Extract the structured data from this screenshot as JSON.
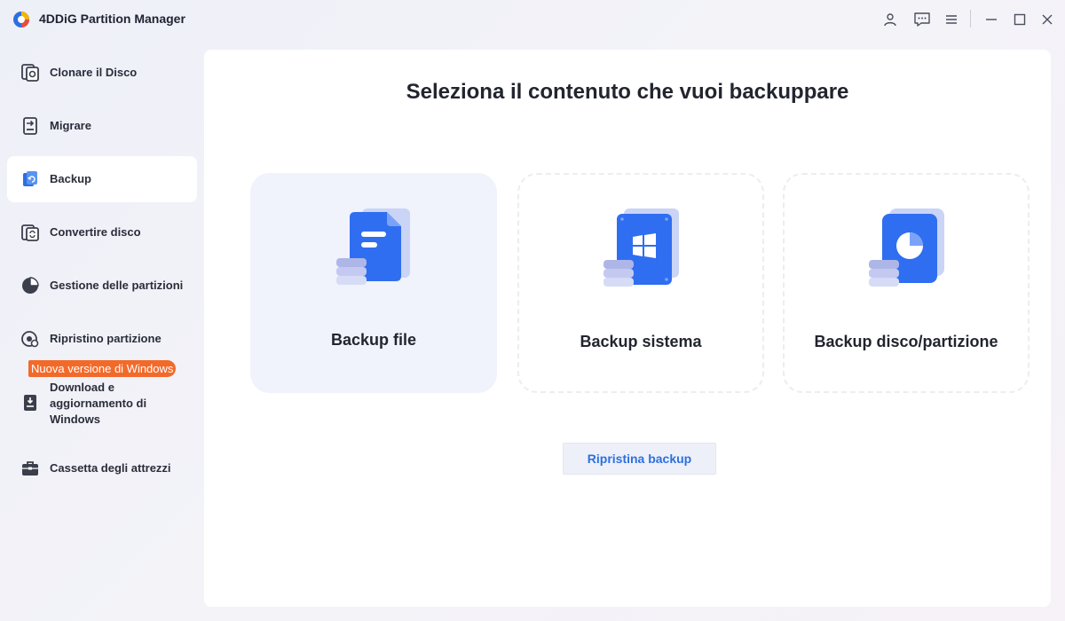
{
  "app": {
    "title": "4DDiG Partition Manager"
  },
  "titlebar": {
    "icons": [
      "user-icon",
      "feedback-icon",
      "menu-icon",
      "minimize-icon",
      "maximize-icon",
      "close-icon"
    ]
  },
  "sidebar": {
    "items": [
      {
        "label": "Clonare il Disco",
        "icon": "clone-disk-icon"
      },
      {
        "label": "Migrare",
        "icon": "migrate-icon"
      },
      {
        "label": "Backup",
        "icon": "backup-icon",
        "active": true
      },
      {
        "label": "Convertire disco",
        "icon": "convert-disk-icon"
      },
      {
        "label": "Gestione delle partizioni",
        "icon": "partition-pie-icon"
      },
      {
        "label": "Ripristino partizione",
        "icon": "partition-recovery-icon"
      },
      {
        "label": "Download e aggiornamento di Windows",
        "icon": "windows-download-icon",
        "badge": "Nuova versione di Windows"
      },
      {
        "label": "Cassetta degli attrezzi",
        "icon": "toolbox-icon"
      }
    ]
  },
  "main": {
    "title": "Seleziona il contenuto che vuoi backuppare",
    "cards": [
      {
        "label": "Backup file",
        "icon": "file-backup-icon",
        "selected": true
      },
      {
        "label": "Backup sistema",
        "icon": "system-backup-icon",
        "selected": false
      },
      {
        "label": "Backup disco/partizione",
        "icon": "disk-partition-backup-icon",
        "selected": false
      }
    ],
    "restore_button": "Ripristina backup"
  },
  "colors": {
    "accent": "#2d6fe0",
    "badge": "#f26a2a",
    "card_selected_bg": "#f0f2fc"
  }
}
